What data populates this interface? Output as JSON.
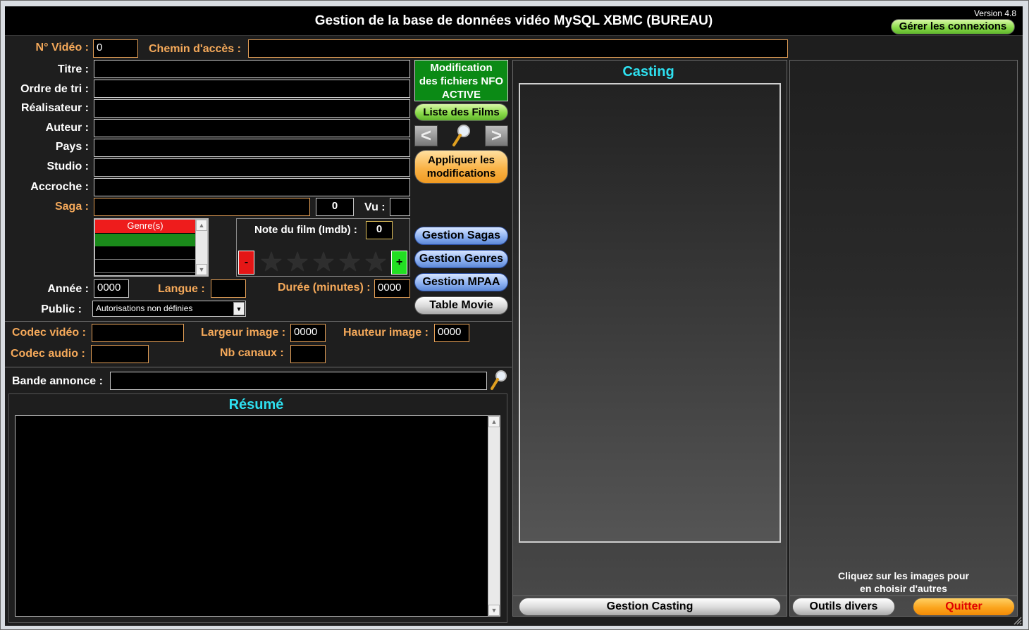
{
  "header": {
    "title": "Gestion de la base de données vidéo MySQL XBMC (BUREAU)",
    "version": "Version 4.8",
    "manage_connections": "Gérer les connexions"
  },
  "video": {
    "number_label": "N° Vidéo :",
    "number_value": "0",
    "path_label": "Chemin d'accès :",
    "path_value": "",
    "title_label": "Titre :",
    "sort_label": "Ordre de tri :",
    "director_label": "Réalisateur :",
    "author_label": "Auteur :",
    "country_label": "Pays :",
    "studio_label": "Studio :",
    "tagline_label": "Accroche :",
    "saga_label": "Saga :",
    "saga_count": "0",
    "seen_label": "Vu :",
    "genres_header": "Genre(s)",
    "rating_label": "Note du film (Imdb) :",
    "rating_value": "0",
    "rating_minus": "-",
    "rating_plus": "+",
    "year_label": "Année :",
    "year_value": "0000",
    "language_label": "Langue :",
    "duration_label": "Durée (minutes) :",
    "duration_value": "0000",
    "public_label": "Public :",
    "public_value": "Autorisations non définies"
  },
  "codec": {
    "video_label": "Codec vidéo :",
    "audio_label": "Codec audio :",
    "width_label": "Largeur image :",
    "width_value": "0000",
    "height_label": "Hauteur image :",
    "height_value": "0000",
    "channels_label": "Nb canaux :"
  },
  "trailer": {
    "label": "Bande annonce :"
  },
  "summary": {
    "title": "Résumé"
  },
  "actions": {
    "nfo_line1": "Modification",
    "nfo_line2": "des fichiers NFO",
    "nfo_line3": "ACTIVE",
    "film_list": "Liste des Films",
    "prev": "<",
    "next": ">",
    "apply_line1": "Appliquer les",
    "apply_line2": "modifications",
    "sagas": "Gestion Sagas",
    "genres": "Gestion Genres",
    "mpaa": "Gestion MPAA",
    "table_movie": "Table Movie"
  },
  "casting": {
    "title": "Casting",
    "manage": "Gestion Casting"
  },
  "images": {
    "hint_line1": "Cliquez sur les images pour",
    "hint_line2": "en choisir d'autres"
  },
  "footer": {
    "tools": "Outils divers",
    "quit": "Quitter"
  },
  "colors": {
    "label_orange": "#f5a95a",
    "section_cyan": "#2ee0f0",
    "nfo_green": "#0b8a15",
    "quit_red": "#e00000"
  },
  "icons": [
    "search-icon",
    "chevron-left-icon",
    "chevron-right-icon",
    "star-icon",
    "dropdown-icon",
    "resize-grip-icon"
  ]
}
